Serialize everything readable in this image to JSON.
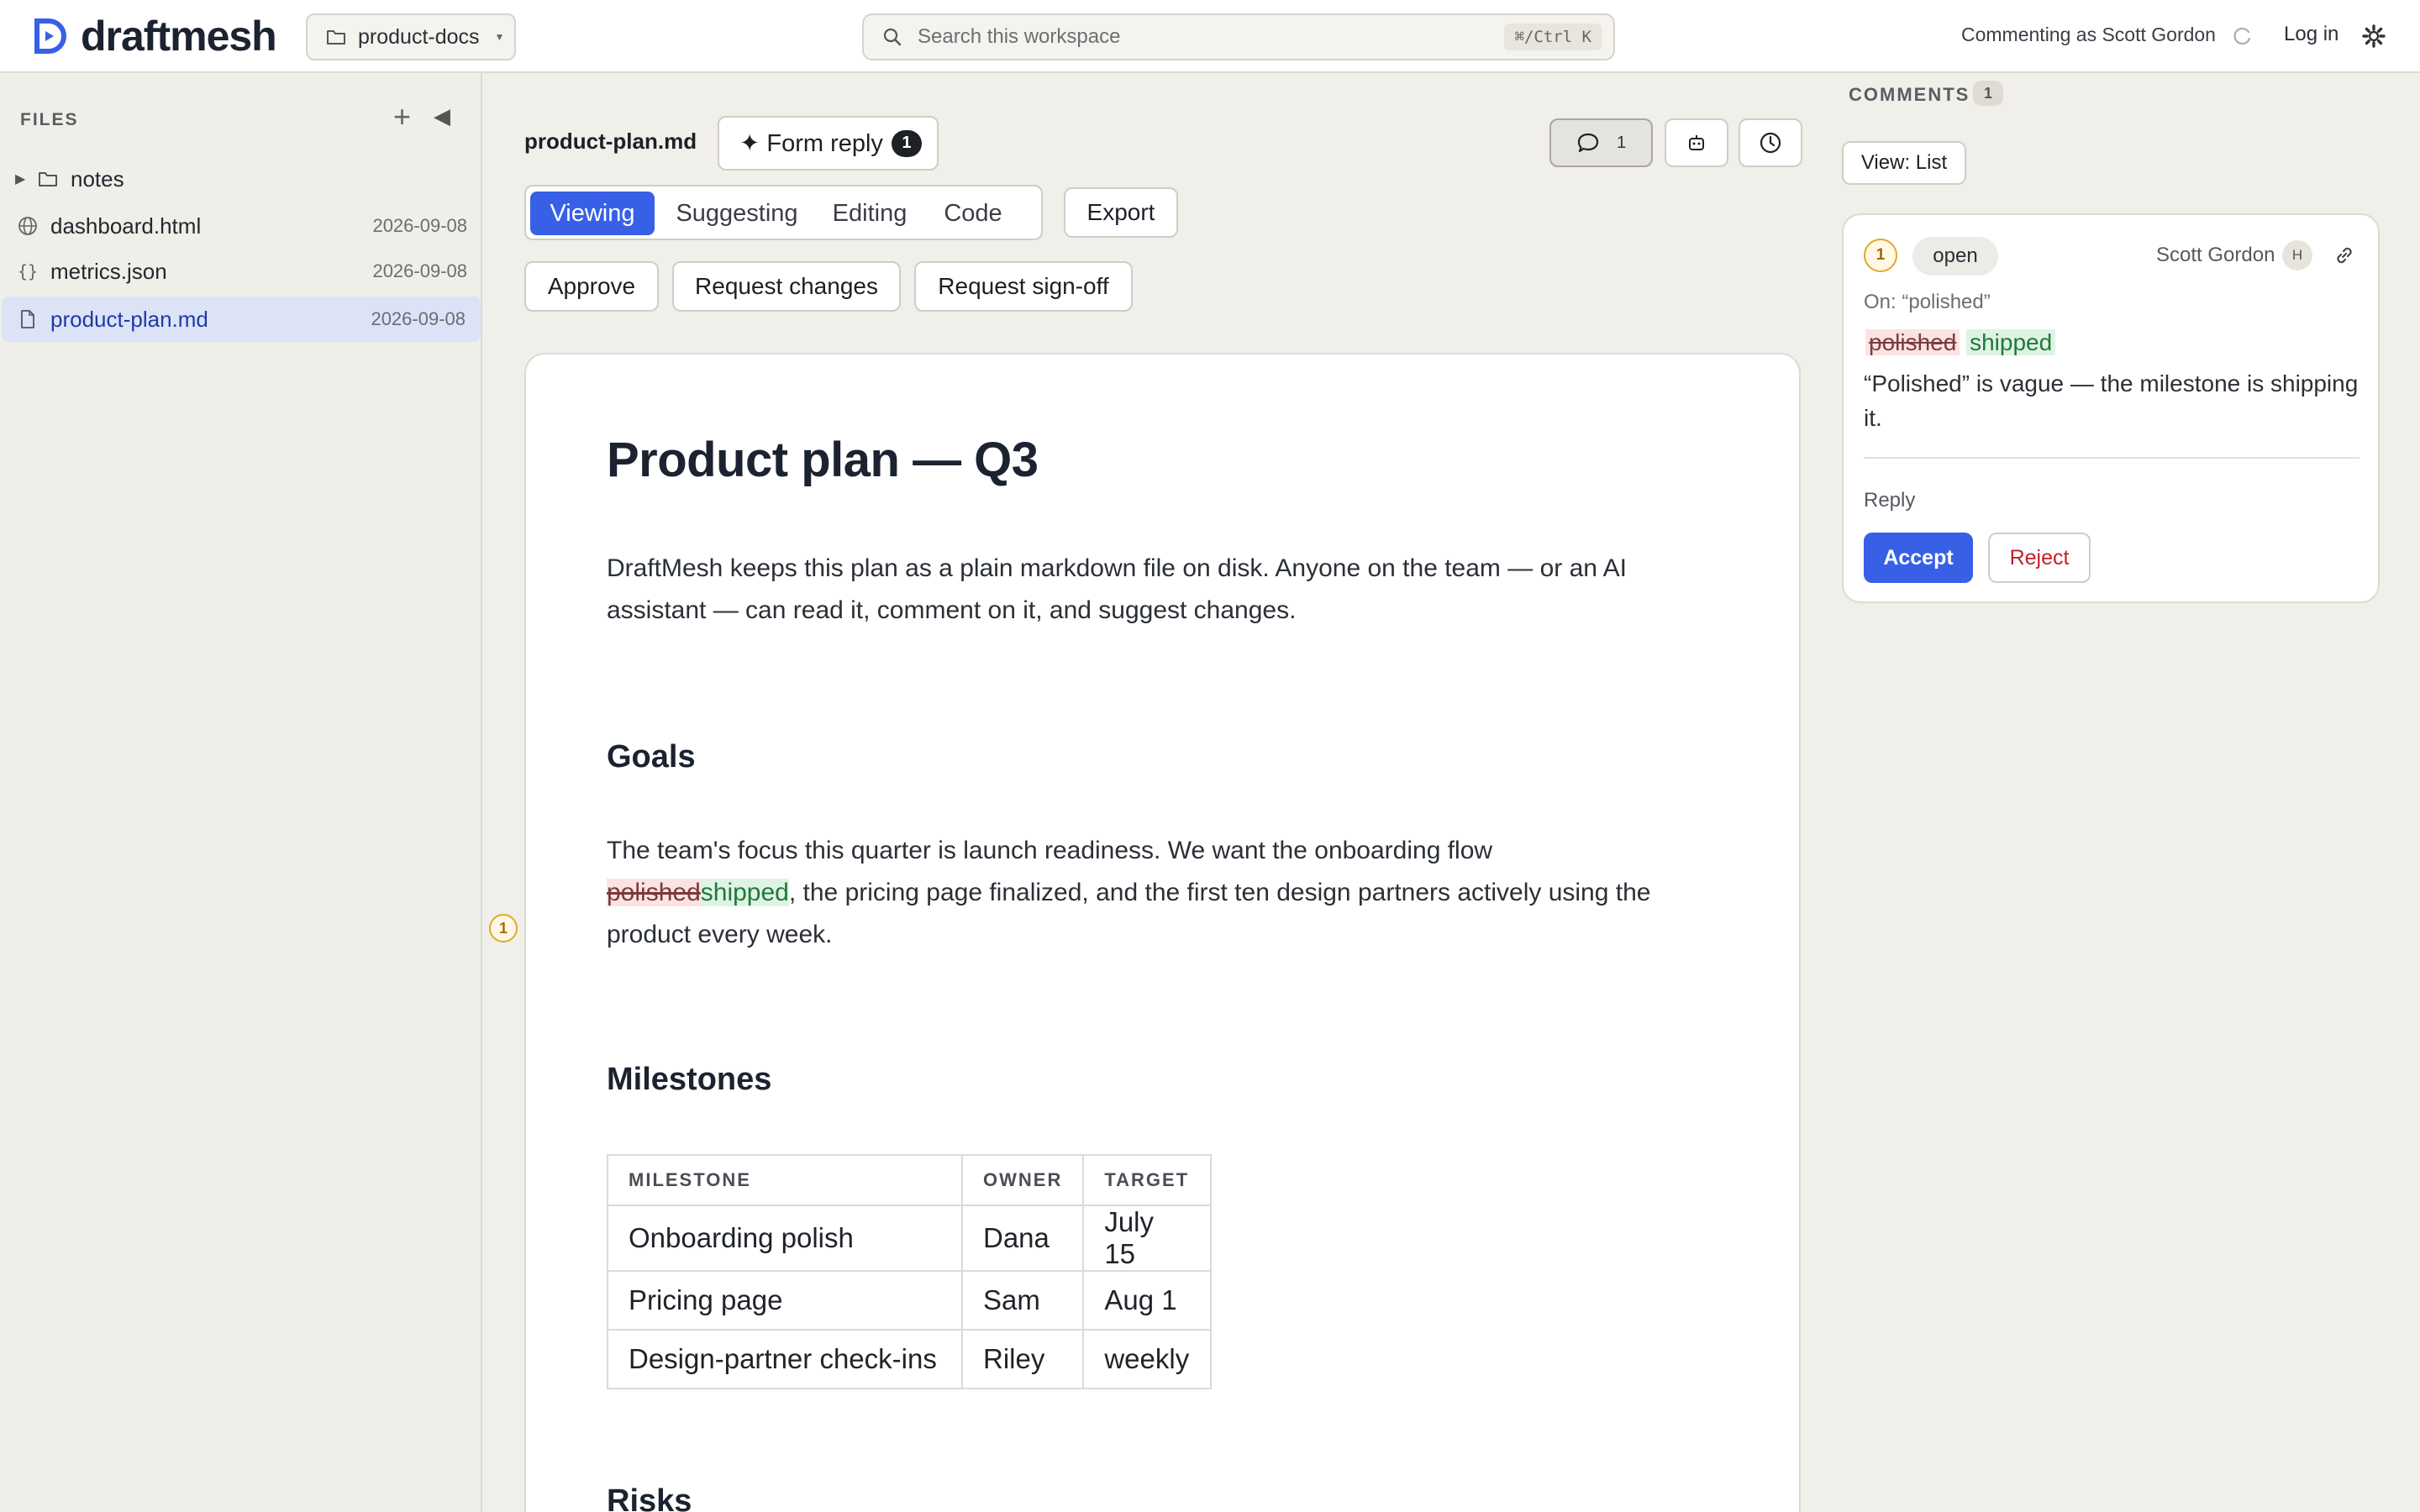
{
  "header": {
    "brand": "draftmesh",
    "workspace": "product-docs",
    "search_placeholder": "Search this workspace",
    "search_shortcut": "⌘/Ctrl K",
    "commenting_as": "Commenting as Scott Gordon",
    "login": "Log in"
  },
  "sidebar": {
    "title": "FILES",
    "items": [
      {
        "name": "notes",
        "type": "folder",
        "date": ""
      },
      {
        "name": "dashboard.html",
        "type": "html",
        "date": "2026-09-08"
      },
      {
        "name": "metrics.json",
        "type": "json",
        "date": "2026-09-08"
      },
      {
        "name": "product-plan.md",
        "type": "markdown",
        "date": "2026-09-08",
        "selected": true
      }
    ]
  },
  "toolbar": {
    "filename": "product-plan.md",
    "form_reply": "✦ Form reply",
    "form_reply_count": "1",
    "comments_count": "1",
    "modes": [
      "Viewing",
      "Suggesting",
      "Editing",
      "Code"
    ],
    "active_mode": "Viewing",
    "export": "Export",
    "actions": [
      "Approve",
      "Request changes",
      "Request sign-off"
    ]
  },
  "document": {
    "title": "Product plan — Q3",
    "intro": "DraftMesh keeps this plan as a plain markdown file on disk. Anyone on the team — or an AI assistant — can read it, comment on it, and suggest changes.",
    "goals_heading": "Goals",
    "goals_before": "The team's focus this quarter is launch readiness. We want the onboarding flow",
    "goals_deleted": "polished",
    "goals_inserted": "shipped",
    "goals_after": ", the pricing page finalized, and the first ten design partners actively using the product every week.",
    "comment_marker": "1",
    "milestones_heading": "Milestones",
    "table": {
      "headers": [
        "MILESTONE",
        "OWNER",
        "TARGET"
      ],
      "rows": [
        [
          "Onboarding polish",
          "Dana",
          "July 15"
        ],
        [
          "Pricing page",
          "Sam",
          "Aug 1"
        ],
        [
          "Design-partner check-ins",
          "Riley",
          "weekly"
        ]
      ]
    },
    "risks_heading": "Risks"
  },
  "comments": {
    "title": "COMMENTS",
    "count": "1",
    "view_toggle": "View: List",
    "card": {
      "number": "1",
      "status": "open",
      "author": "Scott Gordon",
      "avatar": "H",
      "on": "On: “polished”",
      "deleted": "polished",
      "inserted": "shipped",
      "body": "“Polished” is vague — the milestone is shipping it.",
      "reply": "Reply",
      "accept": "Accept",
      "reject": "Reject"
    }
  },
  "colors": {
    "accent": "#3760e6",
    "insert_green": "#1e7a3a",
    "delete_red": "#7a3b3b",
    "marker_amber": "#e0a92b"
  }
}
